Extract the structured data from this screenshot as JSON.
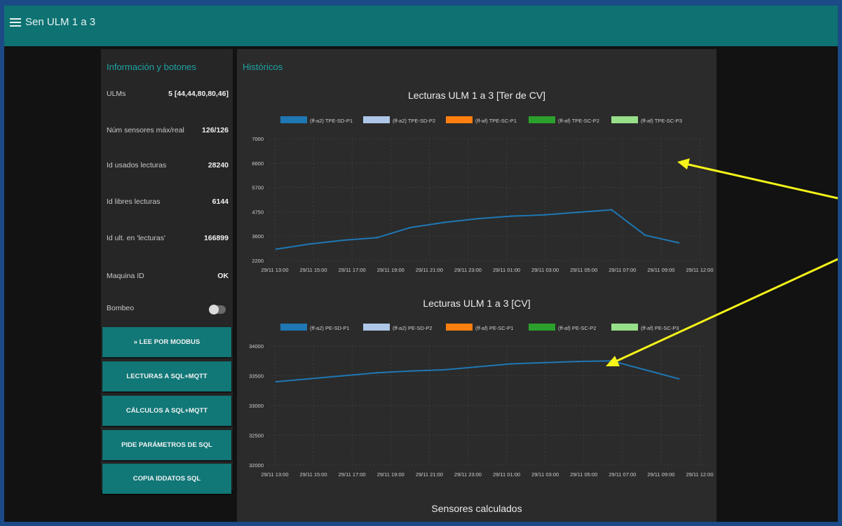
{
  "header": {
    "title": "Sen ULM 1 a 3"
  },
  "info": {
    "title": "Información y botones",
    "rows": [
      {
        "label": "ULMs",
        "value": "5 [44,44,80,80,46]"
      },
      {
        "label": "Núm sensores máx/real",
        "value": "126/126"
      },
      {
        "label": "Id usados lecturas",
        "value": "28240"
      },
      {
        "label": "Id libres lecturas",
        "value": "6144"
      },
      {
        "label": "Id ult. en 'lecturas'",
        "value": "166899"
      },
      {
        "label": "Maquina ID",
        "value": "OK"
      }
    ],
    "toggle_label": "Bombeo",
    "toggle_on": false,
    "buttons": [
      "» LEE POR MODBUS",
      "LECTURAS A SQL+MQTT",
      "CÁLCULOS A SQL+MQTT",
      "PIDE PARÁMETROS DE SQL",
      "COPIA IDDATOS SQL"
    ]
  },
  "historicos": {
    "title": "Históricos",
    "section_bottom": "Sensores calculados"
  },
  "colors": {
    "teal": "#0f7272",
    "series": [
      "#1f77b4",
      "#aec7e8",
      "#ff7f0e",
      "#2ca02c",
      "#98df8a"
    ],
    "arrow": "#f5f51a"
  },
  "chart_data": [
    {
      "type": "line",
      "title": "Lecturas ULM 1 a 3 [Ter de CV]",
      "series": [
        {
          "name": "(ff-a2) TPE-SD-P1",
          "x": [
            "29/11 13:00",
            "29/11 15:00",
            "29/11 17:00",
            "29/11 19:00",
            "29/11 21:00",
            "29/11 23:00",
            "29/11 01:00",
            "29/11 03:00",
            "29/11 05:00",
            "29/11 07:00",
            "29/11 09:00",
            "29/11 10:30",
            "29/11 11:30"
          ],
          "values": [
            2650,
            2850,
            3000,
            3100,
            3500,
            3700,
            3850,
            3950,
            4000,
            4100,
            4200,
            3200,
            2900
          ]
        },
        {
          "name": "(ff-a2) TPE-SD-P2",
          "values": []
        },
        {
          "name": "(ff-af) TPE-SC-P1",
          "values": []
        },
        {
          "name": "(ff-af) TPE-SC-P2",
          "values": []
        },
        {
          "name": "(ff-af) TPE-SC-P3",
          "values": []
        }
      ],
      "y_ticks": [
        "2200",
        "3600",
        "4750",
        "5700",
        "6600",
        "7000"
      ],
      "x_ticks": [
        "29/11 13:00",
        "29/11 15:00",
        "29/11 17:00",
        "29/11 19:00",
        "29/11 21:00",
        "29/11 23:00",
        "29/11 01:00",
        "29/11 03:00",
        "29/11 05:00",
        "29/11 07:00",
        "29/11 09:00",
        "29/11 12:00"
      ]
    },
    {
      "type": "line",
      "title": "Lecturas ULM 1 a 3 [CV]",
      "series": [
        {
          "name": "(ff-a2) PE-SD-P1",
          "values": [
            33400,
            33450,
            33500,
            33550,
            33580,
            33600,
            33650,
            33700,
            33720,
            33740,
            33750,
            33600,
            33450
          ]
        },
        {
          "name": "(ff-a2) PE-SD-P2",
          "values": []
        },
        {
          "name": "(ff-af) PE-SC-P1",
          "values": []
        },
        {
          "name": "(ff-af) PE-SC-P2",
          "values": []
        },
        {
          "name": "(ff-af) PE-SC-P3",
          "values": []
        }
      ],
      "y_ticks": [
        "32000",
        "32500",
        "33000",
        "33500",
        "34000"
      ],
      "x_ticks": [
        "29/11 13:00",
        "29/11 15:00",
        "29/11 17:00",
        "29/11 19:00",
        "29/11 21:00",
        "29/11 23:00",
        "29/11 01:00",
        "29/11 03:00",
        "29/11 05:00",
        "29/11 07:00",
        "29/11 09:00",
        "29/11 12:00"
      ]
    }
  ]
}
